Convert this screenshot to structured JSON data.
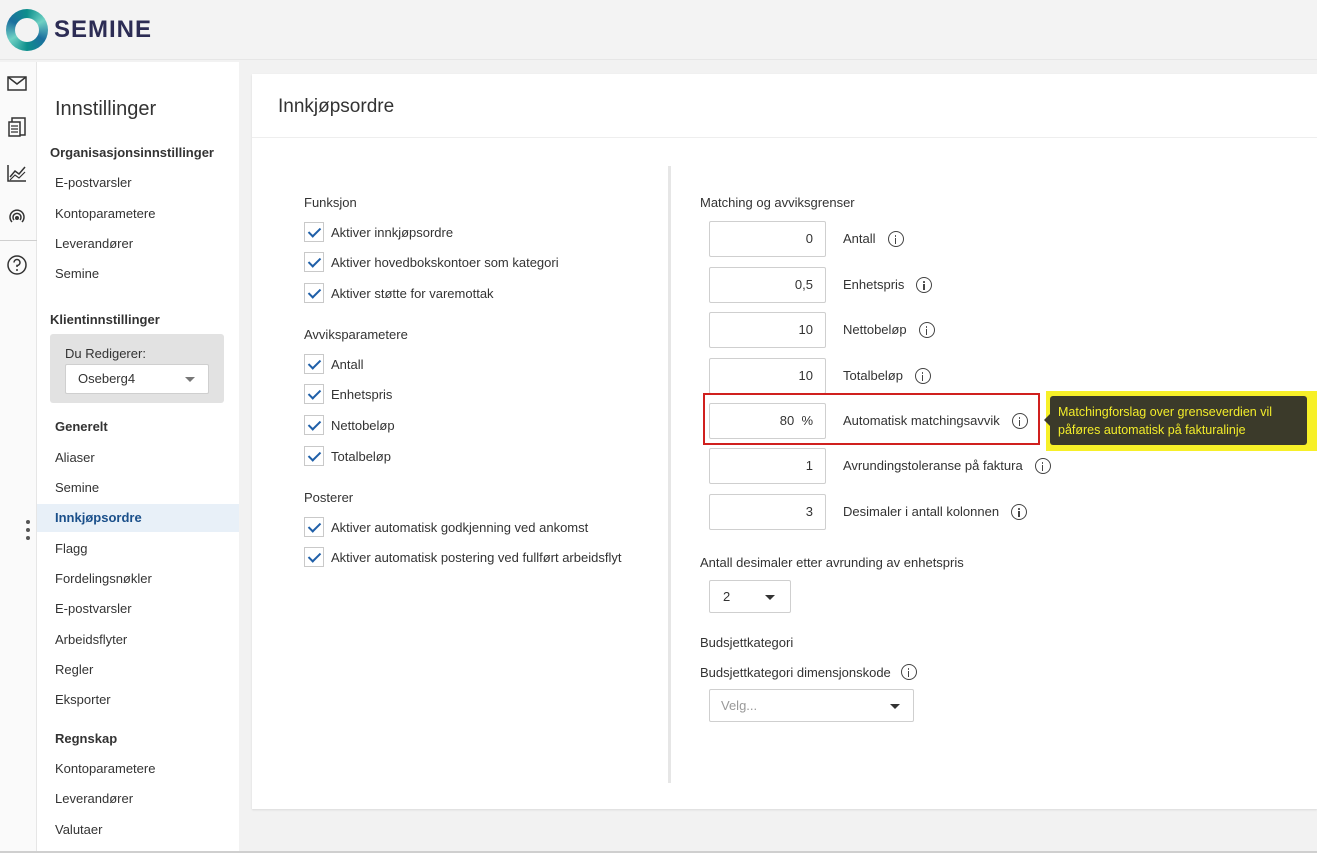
{
  "app": {
    "logo_text": "SEMINE",
    "brand_color": "#0d8f8c"
  },
  "rail": {
    "icons": [
      "mail-icon",
      "documents-icon",
      "chart-icon",
      "broadcast-icon",
      "help-icon",
      "more-icon"
    ]
  },
  "nav": {
    "title": "Innstillinger",
    "org_section": "Organisasjonsinnstillinger",
    "org_items": [
      "E-postvarsler",
      "Kontoparametere",
      "Leverandører",
      "Semine"
    ],
    "client_section": "Klientinnstillinger",
    "editor_label": "Du Redigerer:",
    "editor_value": "Oseberg4",
    "general_group": "Generelt",
    "general_items": [
      "Aliaser",
      "Semine",
      "Innkjøpsordre",
      "Flagg",
      "Fordelingsnøkler",
      "E-postvarsler",
      "Arbeidsflyter",
      "Regler",
      "Eksporter"
    ],
    "active_item": "Innkjøpsordre",
    "accounting_group": "Regnskap",
    "accounting_items": [
      "Kontoparametere",
      "Leverandører",
      "Valutaer"
    ]
  },
  "page": {
    "title": "Innkjøpsordre",
    "functions_label": "Funksjon",
    "functions": [
      "Aktiver innkjøpsordre",
      "Aktiver hovedbokskontoer som kategori",
      "Aktiver støtte for varemottak"
    ],
    "deviation_label": "Avviksparametere",
    "deviations": [
      "Antall",
      "Enhetspris",
      "Nettobeløp",
      "Totalbeløp"
    ],
    "posting_label": "Posterer",
    "postings": [
      "Aktiver automatisk godkjenning ved ankomst",
      "Aktiver automatisk postering ved fullført arbeidsflyt"
    ],
    "matching_label": "Matching og avviksgrenser",
    "matching": [
      {
        "value": "0",
        "label": "Antall"
      },
      {
        "value": "0,5",
        "label": "Enhetspris"
      },
      {
        "value": "10",
        "label": "Nettobeløp"
      },
      {
        "value": "10",
        "label": "Totalbeløp"
      },
      {
        "value": "80",
        "unit": "%",
        "label": "Automatisk matchingsavvik"
      },
      {
        "value": "1",
        "label": "Avrundingstoleranse på faktura"
      },
      {
        "value": "3",
        "label": "Desimaler i antall kolonnen"
      }
    ],
    "tooltip": "Matchingforslag over grenseverdien vil påføres automatisk på fakturalinje",
    "decimals_label": "Antall desimaler etter avrunding av enhetspris",
    "decimals_value": "2",
    "budget_label": "Budsjettkategori",
    "budget_dim_label": "Budsjettkategori dimensjonskode",
    "budget_placeholder": "Velg..."
  }
}
